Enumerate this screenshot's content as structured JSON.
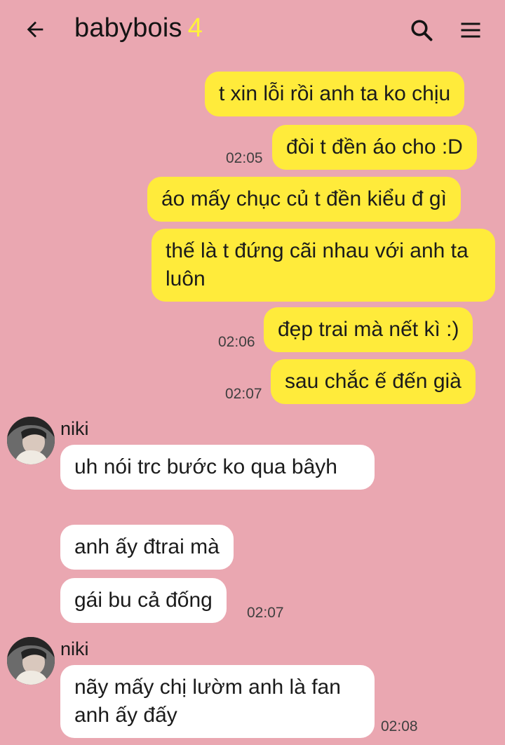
{
  "header": {
    "title": "babybois",
    "member_count": "4",
    "back_icon": "arrow-left-icon",
    "search_icon": "search-icon",
    "menu_icon": "hamburger-menu-icon"
  },
  "messages": [
    {
      "text": "t xin lỗi rồi anh ta ko chịu",
      "time": ""
    },
    {
      "text": "đòi t đền áo cho :D",
      "time": "02:05"
    },
    {
      "text": "áo mấy chục củ t đền kiểu đ gì",
      "time": ""
    },
    {
      "text": "thế là t đứng cãi nhau với anh ta luôn",
      "time": ""
    },
    {
      "text": "đẹp trai mà nết kì :)",
      "time": "02:06"
    },
    {
      "text": "sau chắc ế đến già",
      "time": "02:07"
    },
    {
      "sender": "niki",
      "text": "uh nói trc bước ko qua bâyh",
      "time": ""
    },
    {
      "text": "anh ấy đtrai mà",
      "time": ""
    },
    {
      "text": "gái bu cả đống",
      "time": "02:07"
    },
    {
      "sender": "niki",
      "text": "nãy mấy chị lườm anh là fan anh ấy đấy",
      "time": "02:08"
    }
  ],
  "colors": {
    "background": "#eaa7b1",
    "outgoing_bubble": "#ffeb3b",
    "incoming_bubble": "#ffffff",
    "member_count": "#fff23a"
  }
}
